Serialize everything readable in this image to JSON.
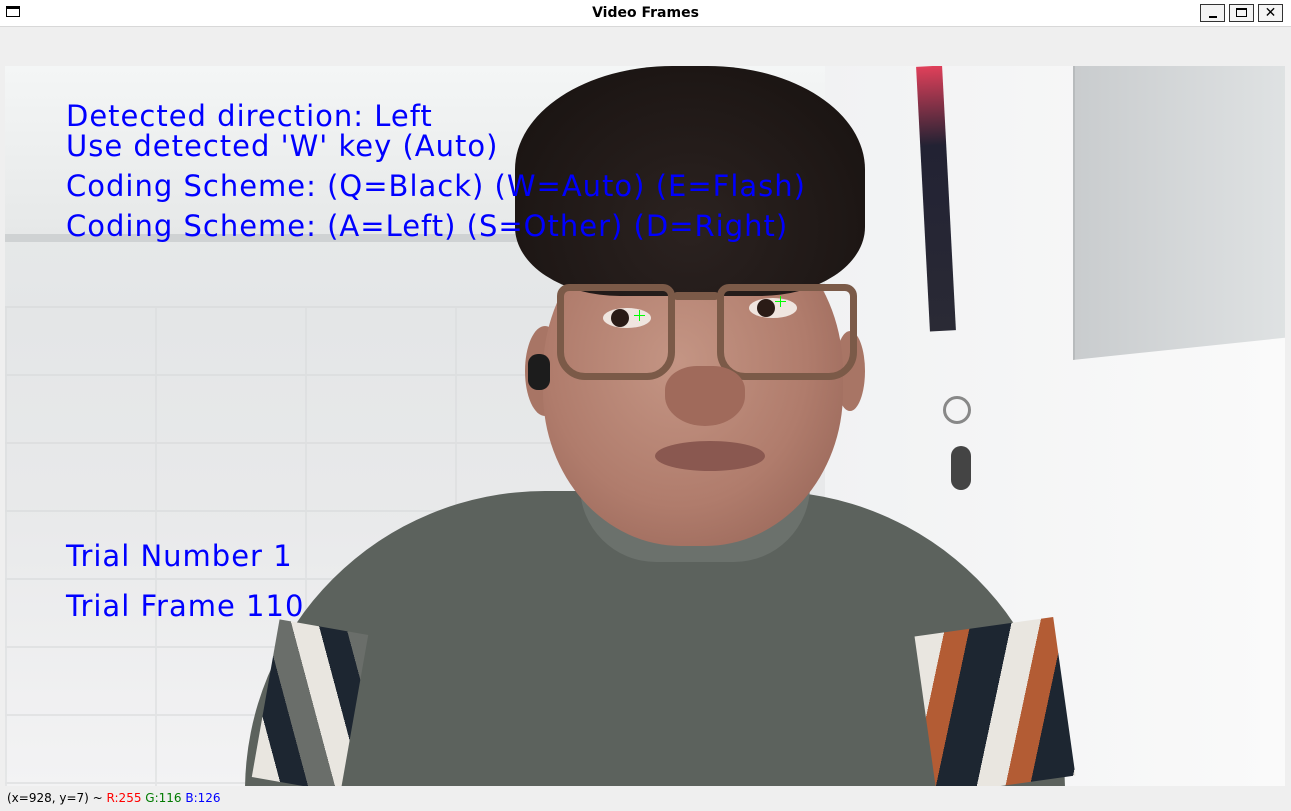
{
  "window": {
    "title": "Video Frames"
  },
  "overlay": {
    "detected_direction": "Detected direction: Left",
    "use_key": "Use detected 'W' key (Auto)",
    "coding_scheme_1": "Coding Scheme: (Q=Black) (W=Auto)  (E=Flash)",
    "coding_scheme_2": "Coding Scheme: (A=Left)  (S=Other) (D=Right)",
    "trial_number": "Trial Number 1",
    "trial_frame": "Trial Frame 110"
  },
  "status": {
    "coords": "(x=928, y=7) ~",
    "r": "R:255",
    "g": "G:116",
    "b": "B:126"
  },
  "colors": {
    "overlay_text": "#0000ff",
    "eye_marker": "#00ff00"
  }
}
